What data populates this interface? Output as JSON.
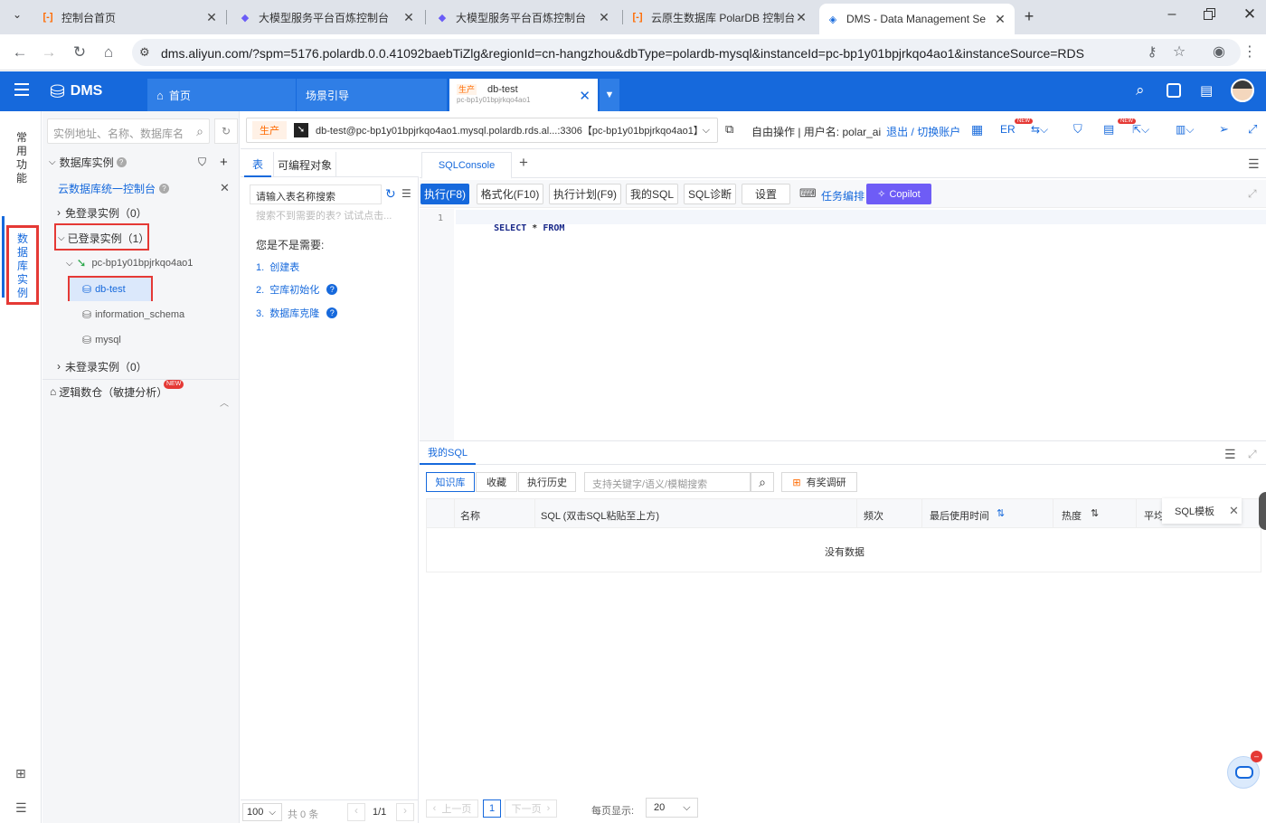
{
  "browser": {
    "tabs": [
      {
        "title": "控制台首页",
        "fav": "[-]"
      },
      {
        "title": "大模型服务平台百炼控制台",
        "fav": "◆"
      },
      {
        "title": "大模型服务平台百炼控制台",
        "fav": "◆"
      },
      {
        "title": "云原生数据库 PolarDB 控制台",
        "fav": "[-]"
      },
      {
        "title": "DMS - Data Management Se",
        "fav": "◈"
      }
    ],
    "url": "dms.aliyun.com/?spm=5176.polardb.0.0.41092baebTiZlg&regionId=cn-hangzhou&dbType=polardb-mysql&instanceId=pc-bp1y01bpjrkqo4ao1&instanceSource=RDS"
  },
  "dms": {
    "logo": "DMS",
    "home_tab": "首页",
    "scene_tab": "场景引导",
    "db_tab_env": "生产",
    "db_tab_name": "db-test",
    "db_tab_sub": "pc-bp1y01bpjrkqo4ao1"
  },
  "rail": {
    "common": "常用功能",
    "instances": "数据库实例"
  },
  "tree": {
    "search_placeholder": "实例地址、名称、数据库名",
    "section_title": "数据库实例",
    "console_link": "云数据库统一控制台",
    "free_login": "免登录实例（0）",
    "logged_in": "已登录实例（1）",
    "instance": "pc-bp1y01bpjrkqo4ao1",
    "db_test": "db-test",
    "info_schema": "information_schema",
    "mysql": "mysql",
    "not_logged": "未登录实例（0）",
    "logic_db": "逻辑数仓（敏捷分析）",
    "new_badge": "NEW"
  },
  "conn": {
    "env": "生产",
    "target": "db-test@pc-bp1y01bpjrkqo4ao1.mysql.polardb.rds.al...:3306【pc-bp1y01bpjrkqo4ao1】",
    "mode": "自由操作 | 用户名: polar_ai",
    "logout": "退出",
    "sep": " / ",
    "switch": "切换账户",
    "er": "ER"
  },
  "objects": {
    "tab_table": "表",
    "tab_prog": "可编程对象",
    "search_placeholder": "请输入表名称搜索",
    "hint": "搜索不到需要的表? 试试点击...",
    "need": "您是不是需要:",
    "links": [
      "1.  创建表",
      "2.  空库初始化",
      "3.  数据库克隆"
    ],
    "page_size": "100",
    "total": "共 0 条",
    "page": "1/1"
  },
  "editor": {
    "tab": "SQLConsole",
    "toolbar": [
      "执行(F8)",
      "格式化(F10)",
      "执行计划(F9)",
      "我的SQL",
      "SQL诊断",
      "设置"
    ],
    "task": "任务编排",
    "copilot": "Copilot",
    "line_no": "1",
    "kw_select": "SELECT",
    "kw_star": "*",
    "kw_from": "FROM"
  },
  "mysql_panel": {
    "title": "我的SQL",
    "tabs": [
      "知识库",
      "收藏",
      "执行历史"
    ],
    "search_placeholder": "支持关键字/语义/模糊搜索",
    "reward": "有奖调研",
    "columns": [
      "名称",
      "SQL (双击SQL粘贴至上方)",
      "频次",
      "最后使用时间",
      "热度",
      "平均"
    ],
    "template": "SQL模板",
    "empty": "没有数据",
    "prev": "上一页",
    "page": "1",
    "next": "下一页",
    "per_page_label": "每页显示:",
    "per_page": "20"
  }
}
